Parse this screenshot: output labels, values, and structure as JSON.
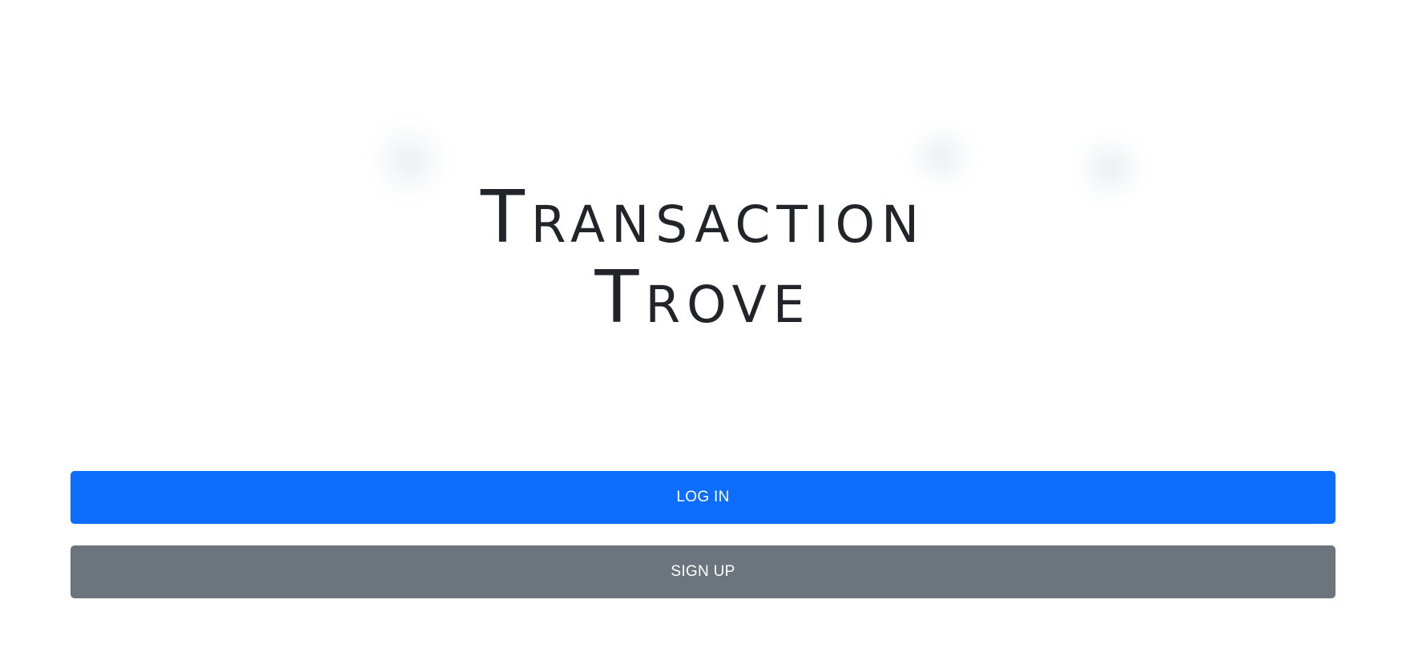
{
  "app": {
    "title_line_1": "Transaction",
    "title_line_2": "Trove"
  },
  "actions": {
    "login_label": "LOG IN",
    "signup_label": "SIGN UP"
  },
  "colors": {
    "primary": "#0d6efd",
    "secondary": "#6c757d",
    "title_text": "#212529",
    "background": "#ffffff"
  }
}
